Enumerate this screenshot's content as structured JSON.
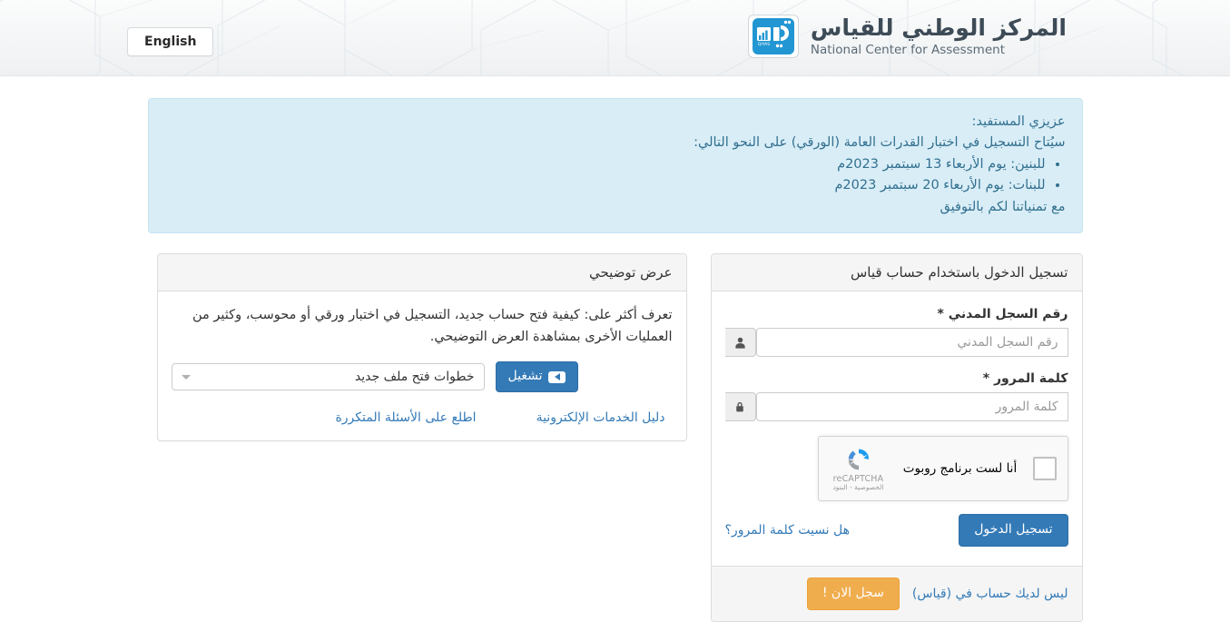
{
  "header": {
    "lang_button": "English",
    "brand_ar": "المركز الوطني للقياس",
    "brand_en": "National Center for Assessment",
    "logo_text": "QIYAS",
    "logo_icon": "qiyas-logo"
  },
  "alert": {
    "line1": "عزيزي المستفيد:",
    "line2": "سيُتاح التسجيل في اختبار القدرات العامة (الورقي) على النحو التالي:",
    "bullets": [
      "للبنين: يوم الأربعاء 13 سبتمبر 2023م",
      "للبنات: يوم الأربعاء 20 سبتمبر 2023م"
    ],
    "line3": "مع تمنياتنا لكم بالتوفيق",
    "bg_color": "#d9edf7",
    "text_color": "#31708f"
  },
  "login": {
    "panel_title": "تسجيل الدخول باستخدام حساب قياس",
    "civil_id": {
      "label": "رقم السجل المدني *",
      "placeholder": "رقم السجل المدني",
      "value": "",
      "icon": "user-icon"
    },
    "password": {
      "label": "كلمة المرور *",
      "placeholder": "كلمة المرور",
      "value": "",
      "icon": "lock-icon"
    },
    "recaptcha": {
      "label": "أنا لست برنامج روبوت",
      "brand": "reCAPTCHA",
      "terms": "الخصوصية - البنود",
      "icon": "recaptcha-icon"
    },
    "forgot_password": "هل نسيت كلمة المرور؟",
    "submit_button": "تسجيل الدخول",
    "submit_color": "#337ab7",
    "footer_text": "ليس لديك حساب في (قياس)",
    "register_button": "سجل الان !",
    "register_color": "#f0ad4e"
  },
  "demo": {
    "panel_title": "عرض توضيحي",
    "description": "تعرف أكثر على: كيفية فتح حساب جديد، التسجيل في اختبار ورقي أو محوسب، وكثير من العمليات الأخرى بمشاهدة العرض التوضيحي.",
    "select_value": "خطوات فتح ملف جديد",
    "play_button": "تشغيل",
    "play_icon": "youtube-play-icon",
    "links": [
      "اطلع على الأسئلة المتكررة",
      "دليل الخدمات الإلكترونية"
    ]
  }
}
